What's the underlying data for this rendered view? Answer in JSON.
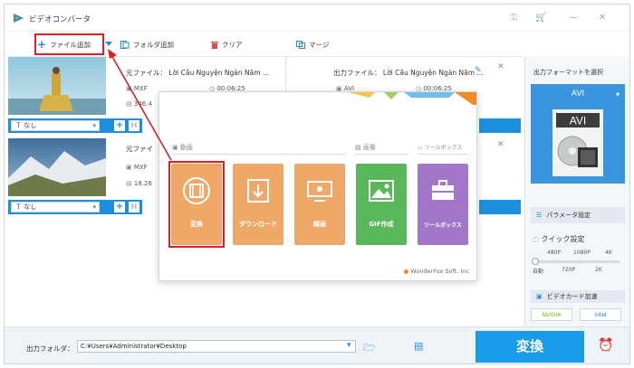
{
  "app": {
    "title": "ビデオコンバータ"
  },
  "toolbar": {
    "add_file": "ファイル追加",
    "add_folder": "フォルダ追加",
    "clear": "クリア",
    "merge": "マージ"
  },
  "files": [
    {
      "input_label": "元ファイル：",
      "input_name": "Lời Cầu Nguyện Ngàn Năm ...",
      "output_label": "出力ファイル：",
      "output_name": "Lời Cầu Nguyện Ngàn Năm ...",
      "in_format": "MXF",
      "in_duration": "00:06:25",
      "in_size": "346.4",
      "out_format": "AVI",
      "out_duration": "00:06:25",
      "subtitle": "なし"
    },
    {
      "input_label": "元ファイ",
      "in_format": "MXF",
      "in_size": "18.26",
      "subtitle": "なし"
    }
  ],
  "popup": {
    "categories": {
      "video": "動画",
      "image": "画像",
      "toolbox": "ツールボックス"
    },
    "tiles": [
      {
        "label": "変換",
        "color": "#f0a868",
        "icon": "film-icon",
        "selected": true
      },
      {
        "label": "ダウンロード",
        "color": "#f0a868",
        "icon": "download-icon"
      },
      {
        "label": "録画",
        "color": "#f0a868",
        "icon": "screen-record-icon"
      },
      {
        "label": "GIF作成",
        "color": "#58b85a",
        "icon": "image-icon"
      },
      {
        "label": "ツールボックス",
        "color": "#a277c9",
        "icon": "toolbox-icon"
      }
    ],
    "brand": "WonderFox Soft, Inc"
  },
  "sidepanel": {
    "title": "出力フォーマットを選択",
    "format": "AVI",
    "format_badge": "AVI",
    "param_button": "パラメータ設定",
    "quick_setting": "クイック設定",
    "quality_top": [
      "480P",
      "1080P",
      "4K"
    ],
    "quality_bottom": [
      "自動",
      "720P",
      "2K"
    ],
    "gpu_title": "ビデオカード加速",
    "gpu_chips": [
      "NVIDIA",
      "intel"
    ]
  },
  "bottom": {
    "output_folder_label": "出力フォルダ：",
    "output_folder_path": "C:¥Users¥Administrator¥Desktop",
    "convert": "変換"
  },
  "colors": {
    "accent": "#1a9be8",
    "highlight": "#e02020",
    "orange": "#f0a868"
  }
}
